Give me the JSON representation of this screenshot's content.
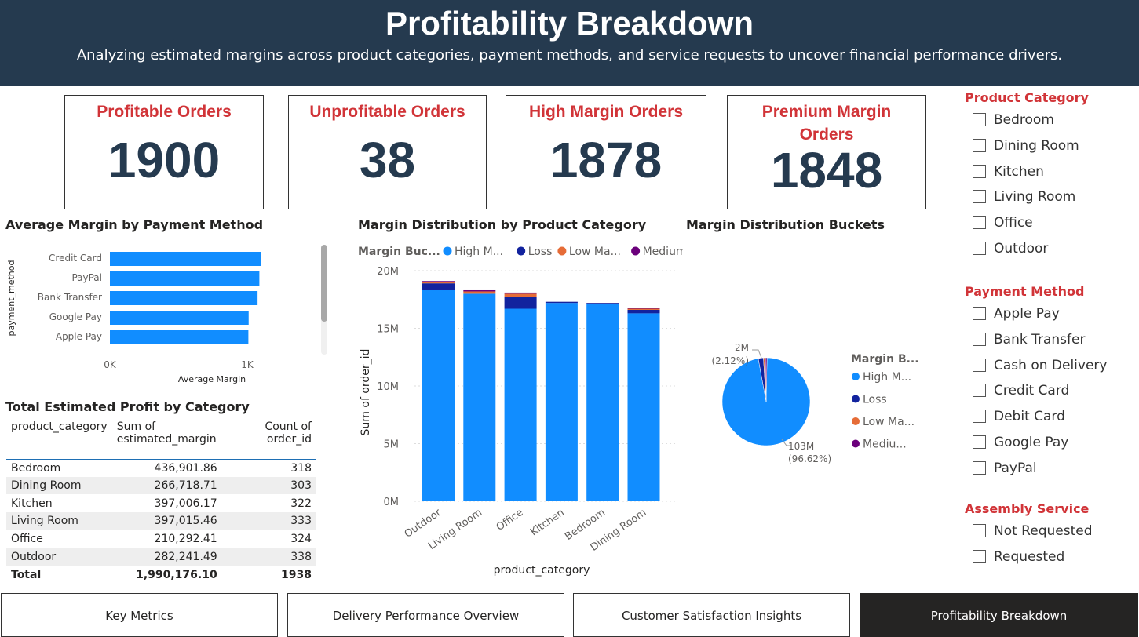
{
  "header": {
    "title": "Profitability Breakdown",
    "subtitle": "Analyzing estimated margins across product categories, payment methods, and service requests to uncover financial performance drivers."
  },
  "kpis": [
    {
      "label": "Profitable Orders",
      "value": "1900"
    },
    {
      "label": "Unprofitable Orders",
      "value": "38"
    },
    {
      "label": "High Margin Orders",
      "value": "1878"
    },
    {
      "label": "Premium Margin Orders",
      "value": "1848"
    }
  ],
  "colors": {
    "header_bg": "#253a4f",
    "accent_red": "#d13438",
    "kpi_value": "#253a4f",
    "high_margin": "#118dff",
    "loss": "#12239e",
    "low_margin": "#e66c37",
    "medium_margin": "#6b007b",
    "nav_active": "#252423"
  },
  "payment_chart": {
    "title": "Average Margin by Payment Method",
    "chart_data": {
      "type": "bar",
      "orientation": "horizontal",
      "categories": [
        "Credit Card",
        "PayPal",
        "Bank Transfer",
        "Google Pay",
        "Apple Pay"
      ],
      "values": [
        1100,
        1088,
        1075,
        1010,
        1008
      ],
      "xlabel": "Average Margin",
      "ylabel": "payment_method",
      "xlim": [
        0,
        1200
      ],
      "xticks": [
        "0K",
        "1K"
      ],
      "xtick_values": [
        0,
        1000
      ],
      "color": "#118dff"
    }
  },
  "category_chart": {
    "title": "Margin Distribution by Product Category",
    "legend_title": "Margin Buc...",
    "chart_data": {
      "type": "bar",
      "stacked": true,
      "categories": [
        "Outdoor",
        "Living Room",
        "Office",
        "Kitchen",
        "Bedroom",
        "Dining Room"
      ],
      "series": [
        {
          "name": "High M...",
          "color": "#118dff",
          "values": [
            18.3,
            18.0,
            16.7,
            17.2,
            17.1,
            16.3
          ]
        },
        {
          "name": "Loss",
          "color": "#12239e",
          "values": [
            0.6,
            0.0,
            1.0,
            0.1,
            0.1,
            0.3
          ]
        },
        {
          "name": "Low Ma...",
          "color": "#e66c37",
          "values": [
            0.1,
            0.2,
            0.3,
            0.0,
            0.0,
            0.1
          ]
        },
        {
          "name": "Medium...",
          "color": "#6b007b",
          "values": [
            0.1,
            0.1,
            0.1,
            0.0,
            0.0,
            0.1
          ]
        }
      ],
      "xlabel": "product_category",
      "ylabel": "Sum of order_id",
      "ylim": [
        0,
        20
      ],
      "yticks": [
        "0M",
        "5M",
        "10M",
        "15M",
        "20M"
      ],
      "ytick_values": [
        0,
        5,
        10,
        15,
        20
      ],
      "grid": true,
      "legend": "top"
    }
  },
  "buckets_chart": {
    "title": "Margin Distribution Buckets",
    "legend_title": "Margin B...",
    "chart_data": {
      "type": "pie",
      "slices": [
        {
          "name": "High M...",
          "value": 103,
          "percent": 96.62,
          "color": "#118dff",
          "label": "103M",
          "label_pct": "(96.62%)"
        },
        {
          "name": "Loss",
          "value": 2,
          "percent": 2.12,
          "color": "#12239e",
          "label": "2M",
          "label_pct": "(2.12%)"
        },
        {
          "name": "Low Ma...",
          "value": 0.8,
          "percent": 0.73,
          "color": "#e66c37",
          "label": "",
          "label_pct": ""
        },
        {
          "name": "Mediu...",
          "value": 0.6,
          "percent": 0.53,
          "color": "#6b007b",
          "label": "",
          "label_pct": ""
        }
      ],
      "legend": "right"
    }
  },
  "profit_table": {
    "title": "Total Estimated Profit by Category",
    "columns": [
      "product_category",
      "Sum of estimated_margin",
      "Count of order_id"
    ],
    "rows": [
      [
        "Bedroom",
        "436,901.86",
        "318"
      ],
      [
        "Dining Room",
        "266,718.71",
        "303"
      ],
      [
        "Kitchen",
        "397,006.17",
        "322"
      ],
      [
        "Living Room",
        "397,015.46",
        "333"
      ],
      [
        "Office",
        "210,292.41",
        "324"
      ],
      [
        "Outdoor",
        "282,241.49",
        "338"
      ]
    ],
    "total": [
      "Total",
      "1,990,176.10",
      "1938"
    ]
  },
  "slicers": [
    {
      "title": "Product Category",
      "items": [
        "Bedroom",
        "Dining Room",
        "Kitchen",
        "Living Room",
        "Office",
        "Outdoor"
      ]
    },
    {
      "title": "Payment Method",
      "items": [
        "Apple Pay",
        "Bank Transfer",
        "Cash on Delivery",
        "Credit Card",
        "Debit Card",
        "Google Pay",
        "PayPal"
      ]
    },
    {
      "title": "Assembly Service",
      "items": [
        "Not Requested",
        "Requested"
      ]
    }
  ],
  "nav": [
    {
      "label": "Key Metrics",
      "active": false
    },
    {
      "label": "Delivery Performance Overview",
      "active": false
    },
    {
      "label": "Customer Satisfaction Insights",
      "active": false
    },
    {
      "label": "Profitability Breakdown",
      "active": true
    }
  ]
}
